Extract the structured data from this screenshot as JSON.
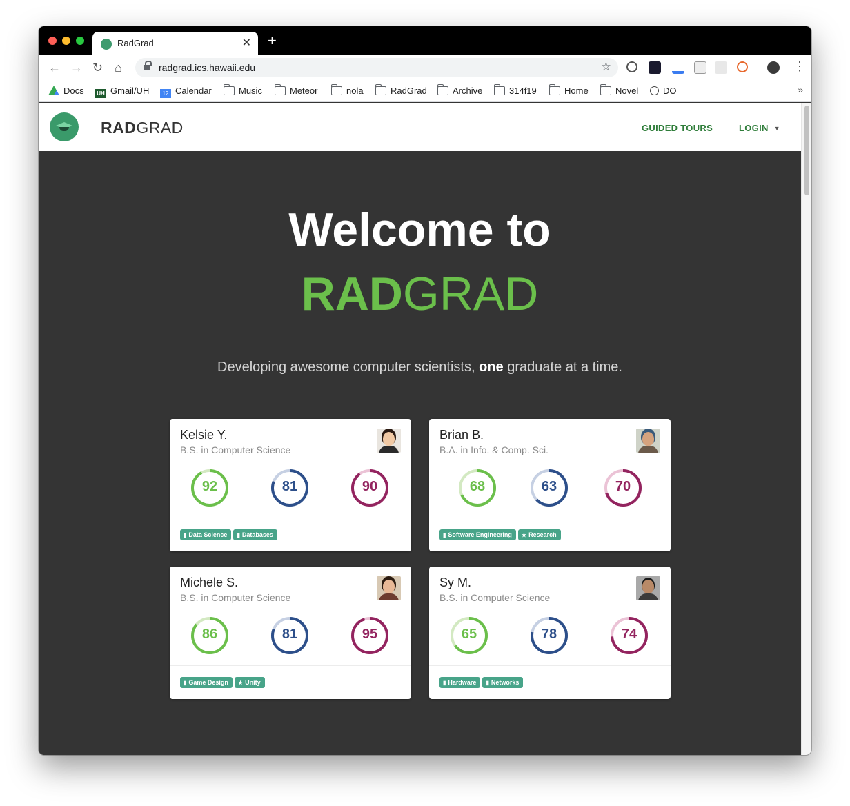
{
  "browser": {
    "tab_title": "RadGrad",
    "new_tab_symbol": "+",
    "tab_close_symbol": "✕",
    "url": "radgrad.ics.hawaii.edu",
    "bookmarks": [
      "Docs",
      "Gmail/UH",
      "Calendar",
      "Music",
      "Meteor",
      "nola",
      "RadGrad",
      "Archive",
      "314f19",
      "Home",
      "Novel",
      "DO"
    ],
    "bookmark_icons": [
      "drive-icon",
      "uh-icon",
      "calendar-icon",
      "folder-icon",
      "folder-icon",
      "folder-icon",
      "folder-icon",
      "folder-icon",
      "folder-icon",
      "folder-icon",
      "folder-icon",
      "globe-icon"
    ],
    "bookmark_badges": {
      "uh": "UH",
      "calendar": "12"
    },
    "overflow_symbol": "»"
  },
  "site": {
    "brand_bold": "RAD",
    "brand_rest": "GRAD",
    "nav": {
      "guided_tours": "GUIDED TOURS",
      "login": "LOGIN"
    },
    "hero": {
      "title": "Welcome to",
      "brand_bold": "RAD",
      "brand_rest": "GRAD",
      "sub_before": "Developing awesome computer scientists, ",
      "sub_bold": "one",
      "sub_after": " graduate at a time."
    },
    "colors": {
      "green": "#6bbf4b",
      "blue": "#2d4f8a",
      "magenta": "#93245f",
      "tag": "#48a489",
      "nav_link": "#2f7d3a"
    }
  },
  "students": [
    {
      "name": "Kelsie Y.",
      "degree": "B.S. in Computer Science",
      "scores": [
        92,
        81,
        90
      ],
      "tags": [
        {
          "label": "Data Science",
          "icon": "briefcase-icon"
        },
        {
          "label": "Databases",
          "icon": "briefcase-icon"
        }
      ]
    },
    {
      "name": "Brian B.",
      "degree": "B.A. in Info. & Comp. Sci.",
      "scores": [
        68,
        63,
        70
      ],
      "tags": [
        {
          "label": "Software Engineering",
          "icon": "briefcase-icon"
        },
        {
          "label": "Research",
          "icon": "star-icon"
        }
      ]
    },
    {
      "name": "Michele S.",
      "degree": "B.S. in Computer Science",
      "scores": [
        86,
        81,
        95
      ],
      "tags": [
        {
          "label": "Game Design",
          "icon": "briefcase-icon"
        },
        {
          "label": "Unity",
          "icon": "star-icon"
        }
      ]
    },
    {
      "name": "Sy M.",
      "degree": "B.S. in Computer Science",
      "scores": [
        65,
        78,
        74
      ],
      "tags": [
        {
          "label": "Hardware",
          "icon": "briefcase-icon"
        },
        {
          "label": "Networks",
          "icon": "briefcase-icon"
        }
      ]
    }
  ]
}
